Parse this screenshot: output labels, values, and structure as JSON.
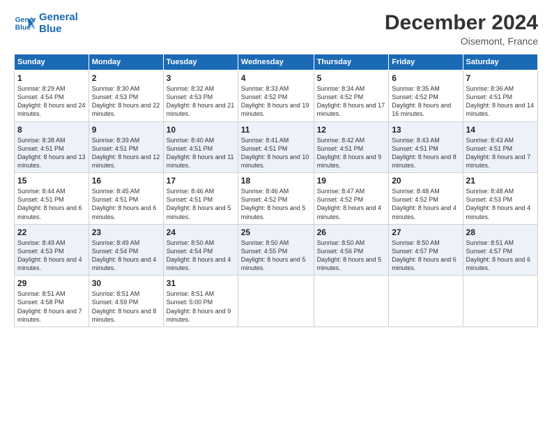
{
  "header": {
    "logo_line1": "General",
    "logo_line2": "Blue",
    "month": "December 2024",
    "location": "Oisemont, France"
  },
  "weekdays": [
    "Sunday",
    "Monday",
    "Tuesday",
    "Wednesday",
    "Thursday",
    "Friday",
    "Saturday"
  ],
  "weeks": [
    [
      {
        "day": "1",
        "sr": "8:29 AM",
        "ss": "4:54 PM",
        "dl": "8 hours and 24 minutes."
      },
      {
        "day": "2",
        "sr": "8:30 AM",
        "ss": "4:53 PM",
        "dl": "8 hours and 22 minutes."
      },
      {
        "day": "3",
        "sr": "8:32 AM",
        "ss": "4:53 PM",
        "dl": "8 hours and 21 minutes."
      },
      {
        "day": "4",
        "sr": "8:33 AM",
        "ss": "4:52 PM",
        "dl": "8 hours and 19 minutes."
      },
      {
        "day": "5",
        "sr": "8:34 AM",
        "ss": "4:52 PM",
        "dl": "8 hours and 17 minutes."
      },
      {
        "day": "6",
        "sr": "8:35 AM",
        "ss": "4:52 PM",
        "dl": "8 hours and 16 minutes."
      },
      {
        "day": "7",
        "sr": "8:36 AM",
        "ss": "4:51 PM",
        "dl": "8 hours and 14 minutes."
      }
    ],
    [
      {
        "day": "8",
        "sr": "8:38 AM",
        "ss": "4:51 PM",
        "dl": "8 hours and 13 minutes."
      },
      {
        "day": "9",
        "sr": "8:39 AM",
        "ss": "4:51 PM",
        "dl": "8 hours and 12 minutes."
      },
      {
        "day": "10",
        "sr": "8:40 AM",
        "ss": "4:51 PM",
        "dl": "8 hours and 11 minutes."
      },
      {
        "day": "11",
        "sr": "8:41 AM",
        "ss": "4:51 PM",
        "dl": "8 hours and 10 minutes."
      },
      {
        "day": "12",
        "sr": "8:42 AM",
        "ss": "4:51 PM",
        "dl": "8 hours and 9 minutes."
      },
      {
        "day": "13",
        "sr": "8:43 AM",
        "ss": "4:51 PM",
        "dl": "8 hours and 8 minutes."
      },
      {
        "day": "14",
        "sr": "8:43 AM",
        "ss": "4:51 PM",
        "dl": "8 hours and 7 minutes."
      }
    ],
    [
      {
        "day": "15",
        "sr": "8:44 AM",
        "ss": "4:51 PM",
        "dl": "8 hours and 6 minutes."
      },
      {
        "day": "16",
        "sr": "8:45 AM",
        "ss": "4:51 PM",
        "dl": "8 hours and 6 minutes."
      },
      {
        "day": "17",
        "sr": "8:46 AM",
        "ss": "4:51 PM",
        "dl": "8 hours and 5 minutes."
      },
      {
        "day": "18",
        "sr": "8:46 AM",
        "ss": "4:52 PM",
        "dl": "8 hours and 5 minutes."
      },
      {
        "day": "19",
        "sr": "8:47 AM",
        "ss": "4:52 PM",
        "dl": "8 hours and 4 minutes."
      },
      {
        "day": "20",
        "sr": "8:48 AM",
        "ss": "4:52 PM",
        "dl": "8 hours and 4 minutes."
      },
      {
        "day": "21",
        "sr": "8:48 AM",
        "ss": "4:53 PM",
        "dl": "8 hours and 4 minutes."
      }
    ],
    [
      {
        "day": "22",
        "sr": "8:49 AM",
        "ss": "4:53 PM",
        "dl": "8 hours and 4 minutes."
      },
      {
        "day": "23",
        "sr": "8:49 AM",
        "ss": "4:54 PM",
        "dl": "8 hours and 4 minutes."
      },
      {
        "day": "24",
        "sr": "8:50 AM",
        "ss": "4:54 PM",
        "dl": "8 hours and 4 minutes."
      },
      {
        "day": "25",
        "sr": "8:50 AM",
        "ss": "4:55 PM",
        "dl": "8 hours and 5 minutes."
      },
      {
        "day": "26",
        "sr": "8:50 AM",
        "ss": "4:56 PM",
        "dl": "8 hours and 5 minutes."
      },
      {
        "day": "27",
        "sr": "8:50 AM",
        "ss": "4:57 PM",
        "dl": "8 hours and 6 minutes."
      },
      {
        "day": "28",
        "sr": "8:51 AM",
        "ss": "4:57 PM",
        "dl": "8 hours and 6 minutes."
      }
    ],
    [
      {
        "day": "29",
        "sr": "8:51 AM",
        "ss": "4:58 PM",
        "dl": "8 hours and 7 minutes."
      },
      {
        "day": "30",
        "sr": "8:51 AM",
        "ss": "4:59 PM",
        "dl": "8 hours and 8 minutes."
      },
      {
        "day": "31",
        "sr": "8:51 AM",
        "ss": "5:00 PM",
        "dl": "8 hours and 9 minutes."
      },
      null,
      null,
      null,
      null
    ]
  ],
  "labels": {
    "sunrise": "Sunrise:",
    "sunset": "Sunset:",
    "daylight": "Daylight:"
  }
}
